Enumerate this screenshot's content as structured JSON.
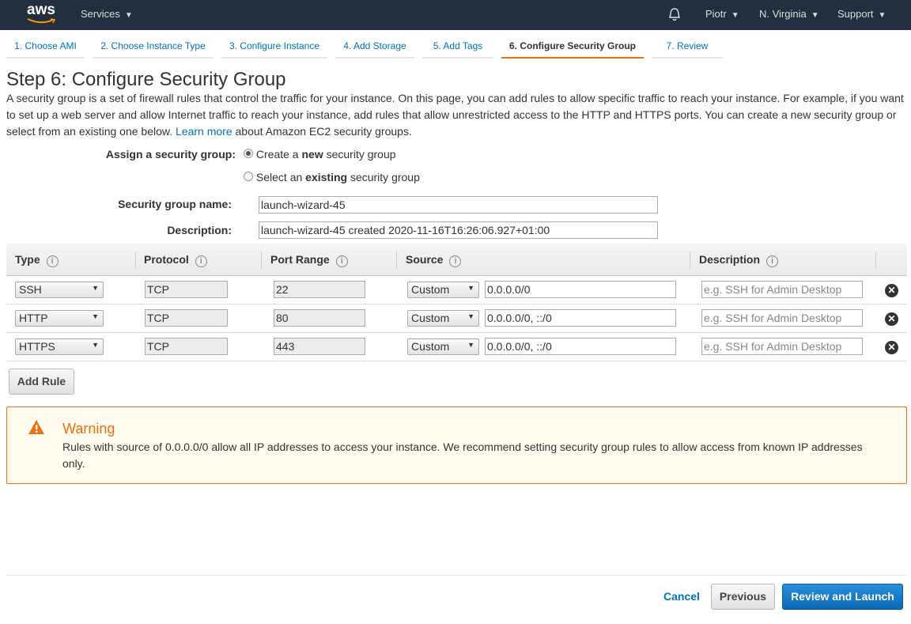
{
  "topbar": {
    "logo": "aws",
    "services": "Services",
    "bell_icon": "bell-icon",
    "user": "Piotr",
    "region": "N. Virginia",
    "support": "Support"
  },
  "steps": [
    "1. Choose AMI",
    "2. Choose Instance Type",
    "3. Configure Instance",
    "4. Add Storage",
    "5. Add Tags",
    "6. Configure Security Group",
    "7. Review"
  ],
  "page": {
    "title": "Step 6: Configure Security Group",
    "intro_before": "A security group is a set of firewall rules that control the traffic for your instance. On this page, you can add rules to allow specific traffic to reach your instance. For example, if you want to set up a web server and allow Internet traffic to reach your instance, add rules that allow unrestricted access to the HTTP and HTTPS ports. You can create a new security group or select from an existing one below.",
    "learn_more": "Learn more",
    "intro_after": "about Amazon EC2 security groups."
  },
  "assign": {
    "label": "Assign a security group:",
    "opt1_pre": "Create a ",
    "opt1_bold": "new",
    "opt1_post": " security group",
    "opt2_pre": "Select an ",
    "opt2_bold": "existing",
    "opt2_post": " security group"
  },
  "form": {
    "name_label": "Security group name:",
    "name_value": "launch-wizard-45",
    "desc_label": "Description:",
    "desc_value": "launch-wizard-45 created 2020-11-16T16:26:06.927+01:00"
  },
  "table": {
    "headers": [
      "Type",
      "Protocol",
      "Port Range",
      "Source",
      "Description"
    ],
    "rows": [
      {
        "type": "SSH",
        "protocol": "TCP",
        "port": "22",
        "source": "Custom",
        "cidr": "0.0.0.0/0",
        "desc_placeholder": "e.g. SSH for Admin Desktop"
      },
      {
        "type": "HTTP",
        "protocol": "TCP",
        "port": "80",
        "source": "Custom",
        "cidr": "0.0.0.0/0, ::/0",
        "desc_placeholder": "e.g. SSH for Admin Desktop"
      },
      {
        "type": "HTTPS",
        "protocol": "TCP",
        "port": "443",
        "source": "Custom",
        "cidr": "0.0.0.0/0, ::/0",
        "desc_placeholder": "e.g. SSH for Admin Desktop"
      }
    ]
  },
  "add_rule": "Add Rule",
  "warning": {
    "title": "Warning",
    "text": "Rules with source of 0.0.0.0/0 allow all IP addresses to access your instance. We recommend setting security group rules to allow access from known IP addresses only.",
    "color": "#ec7211"
  },
  "footer": {
    "cancel": "Cancel",
    "previous": "Previous",
    "review": "Review and Launch"
  }
}
